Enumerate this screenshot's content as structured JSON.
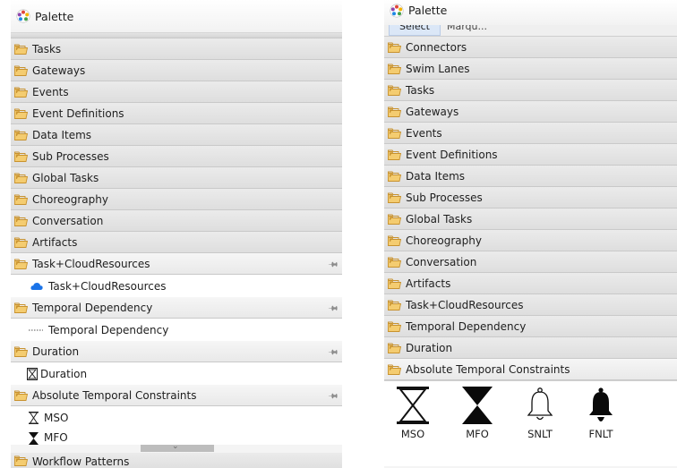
{
  "left_panel": {
    "title": "Palette",
    "drawers": [
      {
        "label": "Tasks"
      },
      {
        "label": "Gateways"
      },
      {
        "label": "Events"
      },
      {
        "label": "Event Definitions"
      },
      {
        "label": "Data Items"
      },
      {
        "label": "Sub Processes"
      },
      {
        "label": "Global Tasks"
      },
      {
        "label": "Choreography"
      },
      {
        "label": "Conversation"
      },
      {
        "label": "Artifacts"
      }
    ],
    "open_drawers": [
      {
        "label": "Task+CloudResources",
        "entry": "Task+CloudResources"
      },
      {
        "label": "Temporal Dependency",
        "entry": "Temporal Dependency"
      },
      {
        "label": "Duration",
        "entry": "Duration"
      },
      {
        "label": "Absolute Temporal Constraints",
        "entries": [
          "MSO",
          "MFO"
        ]
      }
    ],
    "bottom_drawer": "Workflow Patterns"
  },
  "right_panel": {
    "title": "Palette",
    "tools_partial": [
      "Select",
      "Marqu..."
    ],
    "drawers": [
      {
        "label": "Connectors"
      },
      {
        "label": "Swim Lanes"
      },
      {
        "label": "Tasks"
      },
      {
        "label": "Gateways"
      },
      {
        "label": "Events"
      },
      {
        "label": "Event Definitions"
      },
      {
        "label": "Data Items"
      },
      {
        "label": "Sub Processes"
      },
      {
        "label": "Global Tasks"
      },
      {
        "label": "Choreography"
      },
      {
        "label": "Conversation"
      },
      {
        "label": "Artifacts"
      },
      {
        "label": "Task+CloudResources"
      },
      {
        "label": "Temporal Dependency"
      },
      {
        "label": "Duration"
      },
      {
        "label": "Absolute Temporal Constraints"
      }
    ],
    "tools": [
      {
        "label": "MSO",
        "icon": "hourglass-outline-icon"
      },
      {
        "label": "MFO",
        "icon": "hourglass-filled-icon"
      },
      {
        "label": "SNLT",
        "icon": "bell-outline-icon"
      },
      {
        "label": "FNLT",
        "icon": "bell-filled-icon"
      }
    ]
  },
  "colors": {
    "folder": "#f0c060",
    "folder_edge": "#c8922e",
    "cloud": "#1a73e8",
    "selection": "#dbe7f7"
  }
}
